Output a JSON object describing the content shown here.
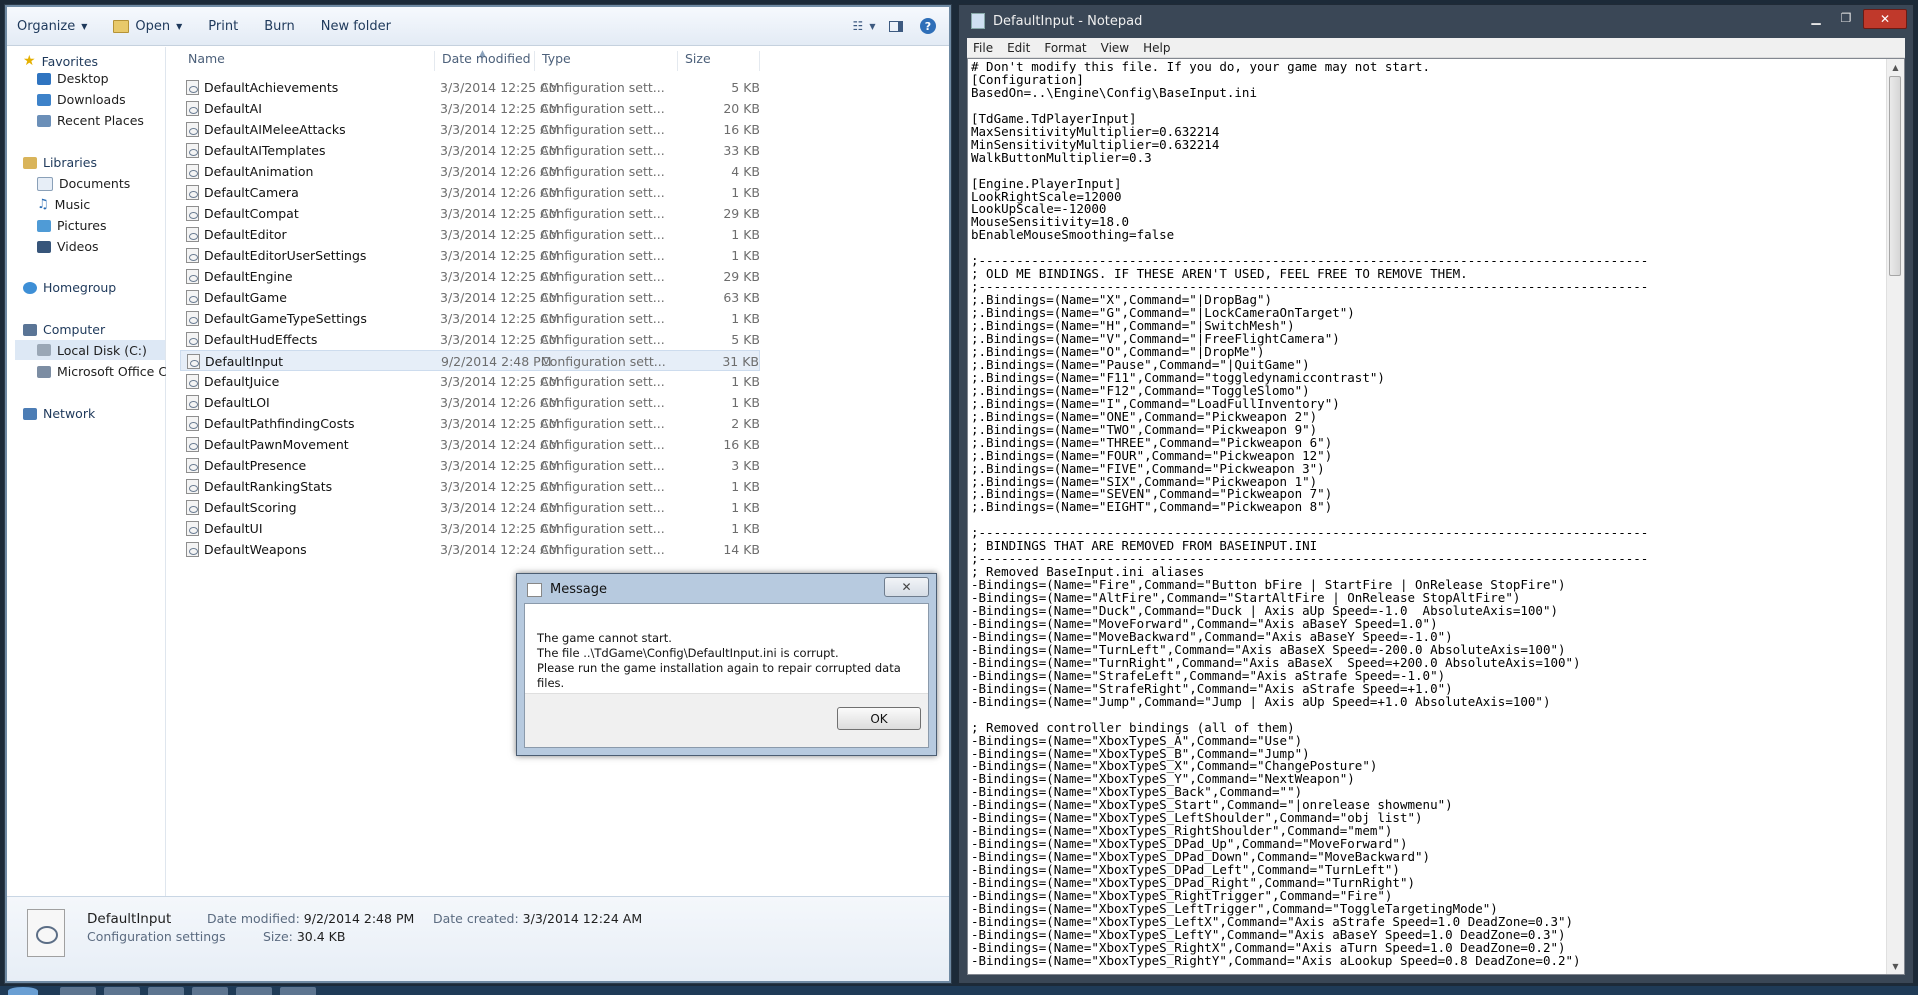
{
  "explorer": {
    "toolbar": {
      "organize": "Organize",
      "open": "Open",
      "print": "Print",
      "burn": "Burn",
      "new_folder": "New folder"
    },
    "nav": {
      "favorites": "Favorites",
      "desktop": "Desktop",
      "downloads": "Downloads",
      "recent": "Recent Places",
      "libraries": "Libraries",
      "documents": "Documents",
      "music": "Music",
      "pictures": "Pictures",
      "videos": "Videos",
      "homegroup": "Homegroup",
      "computer": "Computer",
      "local_disk": "Local Disk (C:)",
      "ms_office": "Microsoft Office Clic",
      "network": "Network"
    },
    "columns": {
      "name": "Name",
      "date": "Date modified",
      "type": "Type",
      "size": "Size"
    },
    "files": [
      {
        "name": "DefaultAchievements",
        "date": "3/3/2014 12:25 AM",
        "type": "Configuration sett...",
        "size": "5 KB"
      },
      {
        "name": "DefaultAI",
        "date": "3/3/2014 12:25 AM",
        "type": "Configuration sett...",
        "size": "20 KB"
      },
      {
        "name": "DefaultAIMeleeAttacks",
        "date": "3/3/2014 12:25 AM",
        "type": "Configuration sett...",
        "size": "16 KB"
      },
      {
        "name": "DefaultAITemplates",
        "date": "3/3/2014 12:25 AM",
        "type": "Configuration sett...",
        "size": "33 KB"
      },
      {
        "name": "DefaultAnimation",
        "date": "3/3/2014 12:26 AM",
        "type": "Configuration sett...",
        "size": "4 KB"
      },
      {
        "name": "DefaultCamera",
        "date": "3/3/2014 12:26 AM",
        "type": "Configuration sett...",
        "size": "1 KB"
      },
      {
        "name": "DefaultCompat",
        "date": "3/3/2014 12:25 AM",
        "type": "Configuration sett...",
        "size": "29 KB"
      },
      {
        "name": "DefaultEditor",
        "date": "3/3/2014 12:25 AM",
        "type": "Configuration sett...",
        "size": "1 KB"
      },
      {
        "name": "DefaultEditorUserSettings",
        "date": "3/3/2014 12:25 AM",
        "type": "Configuration sett...",
        "size": "1 KB"
      },
      {
        "name": "DefaultEngine",
        "date": "3/3/2014 12:25 AM",
        "type": "Configuration sett...",
        "size": "29 KB"
      },
      {
        "name": "DefaultGame",
        "date": "3/3/2014 12:25 AM",
        "type": "Configuration sett...",
        "size": "63 KB"
      },
      {
        "name": "DefaultGameTypeSettings",
        "date": "3/3/2014 12:25 AM",
        "type": "Configuration sett...",
        "size": "1 KB"
      },
      {
        "name": "DefaultHudEffects",
        "date": "3/3/2014 12:25 AM",
        "type": "Configuration sett...",
        "size": "5 KB"
      },
      {
        "name": "DefaultInput",
        "date": "9/2/2014 2:48 PM",
        "type": "Configuration sett...",
        "size": "31 KB"
      },
      {
        "name": "DefaultJuice",
        "date": "3/3/2014 12:25 AM",
        "type": "Configuration sett...",
        "size": "1 KB"
      },
      {
        "name": "DefaultLOI",
        "date": "3/3/2014 12:26 AM",
        "type": "Configuration sett...",
        "size": "1 KB"
      },
      {
        "name": "DefaultPathfindingCosts",
        "date": "3/3/2014 12:25 AM",
        "type": "Configuration sett...",
        "size": "2 KB"
      },
      {
        "name": "DefaultPawnMovement",
        "date": "3/3/2014 12:24 AM",
        "type": "Configuration sett...",
        "size": "16 KB"
      },
      {
        "name": "DefaultPresence",
        "date": "3/3/2014 12:25 AM",
        "type": "Configuration sett...",
        "size": "3 KB"
      },
      {
        "name": "DefaultRankingStats",
        "date": "3/3/2014 12:25 AM",
        "type": "Configuration sett...",
        "size": "1 KB"
      },
      {
        "name": "DefaultScoring",
        "date": "3/3/2014 12:24 AM",
        "type": "Configuration sett...",
        "size": "1 KB"
      },
      {
        "name": "DefaultUI",
        "date": "3/3/2014 12:25 AM",
        "type": "Configuration sett...",
        "size": "1 KB"
      },
      {
        "name": "DefaultWeapons",
        "date": "3/3/2014 12:24 AM",
        "type": "Configuration sett...",
        "size": "14 KB"
      }
    ],
    "details": {
      "name": "DefaultInput",
      "type": "Configuration settings",
      "modified_label": "Date modified:",
      "modified_value": "9/2/2014 2:48 PM",
      "created_label": "Date created:",
      "created_value": "3/3/2014 12:24 AM",
      "size_label": "Size:",
      "size_value": "30.4 KB"
    }
  },
  "dialog": {
    "title": "Message",
    "line1": "The game cannot start.",
    "line2": "The file ..\\TdGame\\Config\\DefaultInput.ini is corrupt.",
    "line3": "Please run the game installation again to repair corrupted data files.",
    "ok": "OK"
  },
  "notepad": {
    "title": "DefaultInput - Notepad",
    "menu": {
      "file": "File",
      "edit": "Edit",
      "format": "Format",
      "view": "View",
      "help": "Help"
    },
    "text": "# Don't modify this file. If you do, your game may not start.\n[Configuration]\nBasedOn=..\\Engine\\Config\\BaseInput.ini\n\n[TdGame.TdPlayerInput]\nMaxSensitivityMultiplier=0.632214\nMinSensitivityMultiplier=0.632214\nWalkButtonMultiplier=0.3\n\n[Engine.PlayerInput]\nLookRightScale=12000\nLookUpScale=-12000\nMouseSensitivity=18.0\nbEnableMouseSmoothing=false\n\n;-----------------------------------------------------------------------------------------\n; OLD ME BINDINGS. IF THESE AREN'T USED, FEEL FREE TO REMOVE THEM.\n;-----------------------------------------------------------------------------------------\n;.Bindings=(Name=\"X\",Command=\"|DropBag\")\n;.Bindings=(Name=\"G\",Command=\"|LockCameraOnTarget\")\n;.Bindings=(Name=\"H\",Command=\"|SwitchMesh\")\n;.Bindings=(Name=\"V\",Command=\"|FreeFlightCamera\")\n;.Bindings=(Name=\"O\",Command=\"|DropMe\")\n;.Bindings=(Name=\"Pause\",Command=\"|QuitGame\")\n;.Bindings=(Name=\"F11\",Command=\"toggledynamiccontrast\")\n;.Bindings=(Name=\"F12\",Command=\"ToggleSlomo\")\n;.Bindings=(Name=\"I\",Command=\"LoadFullInventory\")\n;.Bindings=(Name=\"ONE\",Command=\"Pickweapon 2\")\n;.Bindings=(Name=\"TWO\",Command=\"Pickweapon 9\")\n;.Bindings=(Name=\"THREE\",Command=\"Pickweapon 6\")\n;.Bindings=(Name=\"FOUR\",Command=\"Pickweapon 12\")\n;.Bindings=(Name=\"FIVE\",Command=\"Pickweapon 3\")\n;.Bindings=(Name=\"SIX\",Command=\"Pickweapon 1\")\n;.Bindings=(Name=\"SEVEN\",Command=\"Pickweapon 7\")\n;.Bindings=(Name=\"EIGHT\",Command=\"Pickweapon 8\")\n\n;-----------------------------------------------------------------------------------------\n; BINDINGS THAT ARE REMOVED FROM BASEINPUT.INI\n;-----------------------------------------------------------------------------------------\n; Removed BaseInput.ini aliases\n-Bindings=(Name=\"Fire\",Command=\"Button bFire | StartFire | OnRelease StopFire\")\n-Bindings=(Name=\"AltFire\",Command=\"StartAltFire | OnRelease StopAltFire\")\n-Bindings=(Name=\"Duck\",Command=\"Duck | Axis aUp Speed=-1.0  AbsoluteAxis=100\")\n-Bindings=(Name=\"MoveForward\",Command=\"Axis aBaseY Speed=1.0\")\n-Bindings=(Name=\"MoveBackward\",Command=\"Axis aBaseY Speed=-1.0\")\n-Bindings=(Name=\"TurnLeft\",Command=\"Axis aBaseX Speed=-200.0 AbsoluteAxis=100\")\n-Bindings=(Name=\"TurnRight\",Command=\"Axis aBaseX  Speed=+200.0 AbsoluteAxis=100\")\n-Bindings=(Name=\"StrafeLeft\",Command=\"Axis aStrafe Speed=-1.0\")\n-Bindings=(Name=\"StrafeRight\",Command=\"Axis aStrafe Speed=+1.0\")\n-Bindings=(Name=\"Jump\",Command=\"Jump | Axis aUp Speed=+1.0 AbsoluteAxis=100\")\n\n; Removed controller bindings (all of them)\n-Bindings=(Name=\"XboxTypeS_A\",Command=\"Use\")\n-Bindings=(Name=\"XboxTypeS_B\",Command=\"Jump\")\n-Bindings=(Name=\"XboxTypeS_X\",Command=\"ChangePosture\")\n-Bindings=(Name=\"XboxTypeS_Y\",Command=\"NextWeapon\")\n-Bindings=(Name=\"XboxTypeS_Back\",Command=\"\")\n-Bindings=(Name=\"XboxTypeS_Start\",Command=\"|onrelease showmenu\")\n-Bindings=(Name=\"XboxTypeS_LeftShoulder\",Command=\"obj list\")\n-Bindings=(Name=\"XboxTypeS_RightShoulder\",Command=\"mem\")\n-Bindings=(Name=\"XboxTypeS_DPad_Up\",Command=\"MoveForward\")\n-Bindings=(Name=\"XboxTypeS_DPad_Down\",Command=\"MoveBackward\")\n-Bindings=(Name=\"XboxTypeS_DPad_Left\",Command=\"TurnLeft\")\n-Bindings=(Name=\"XboxTypeS_DPad_Right\",Command=\"TurnRight\")\n-Bindings=(Name=\"XboxTypeS_RightTrigger\",Command=\"Fire\")\n-Bindings=(Name=\"XboxTypeS_LeftTrigger\",Command=\"ToggleTargetingMode\")\n-Bindings=(Name=\"XboxTypeS_LeftX\",Command=\"Axis aStrafe Speed=1.0 DeadZone=0.3\")\n-Bindings=(Name=\"XboxTypeS_LeftY\",Command=\"Axis aBaseY Speed=1.0 DeadZone=0.3\")\n-Bindings=(Name=\"XboxTypeS_RightX\",Command=\"Axis aTurn Speed=1.0 DeadZone=0.2\")\n-Bindings=(Name=\"XboxTypeS_RightY\",Command=\"Axis aLookup Speed=0.8 DeadZone=0.2\")"
  }
}
